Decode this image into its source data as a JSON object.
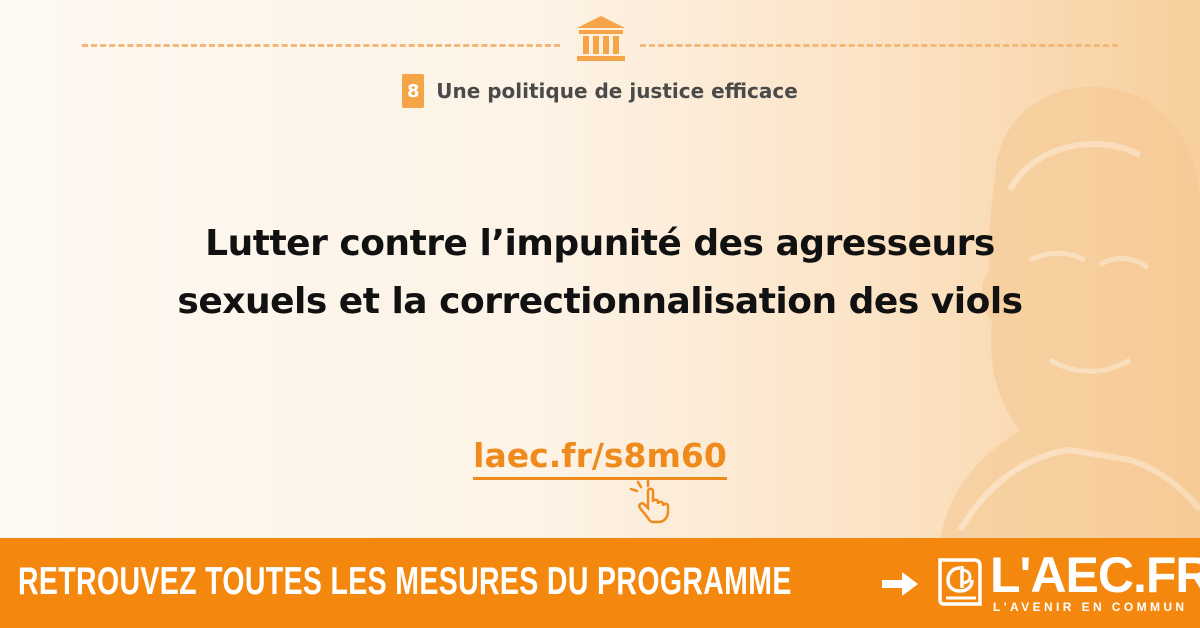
{
  "topic": {
    "number": "8",
    "label": "Une politique de justice efficace",
    "icon": "bank-icon"
  },
  "headline": {
    "line1": "Lutter contre l’impunité des agresseurs",
    "line2": "sexuels et la correctionnalisation des viols"
  },
  "link": {
    "text": "laec.fr/s8m60",
    "icon": "hand-pointer-icon"
  },
  "footer": {
    "cta": "RETROUVEZ TOUTES LES MESURES DU PROGRAMME",
    "brand": "L'AEC.FR",
    "tagline": "L'AVENIR EN COMMUN"
  },
  "colors": {
    "accent": "#f4880f",
    "link": "#ef8a1d",
    "badge": "#f5a547",
    "text": "#111111"
  }
}
